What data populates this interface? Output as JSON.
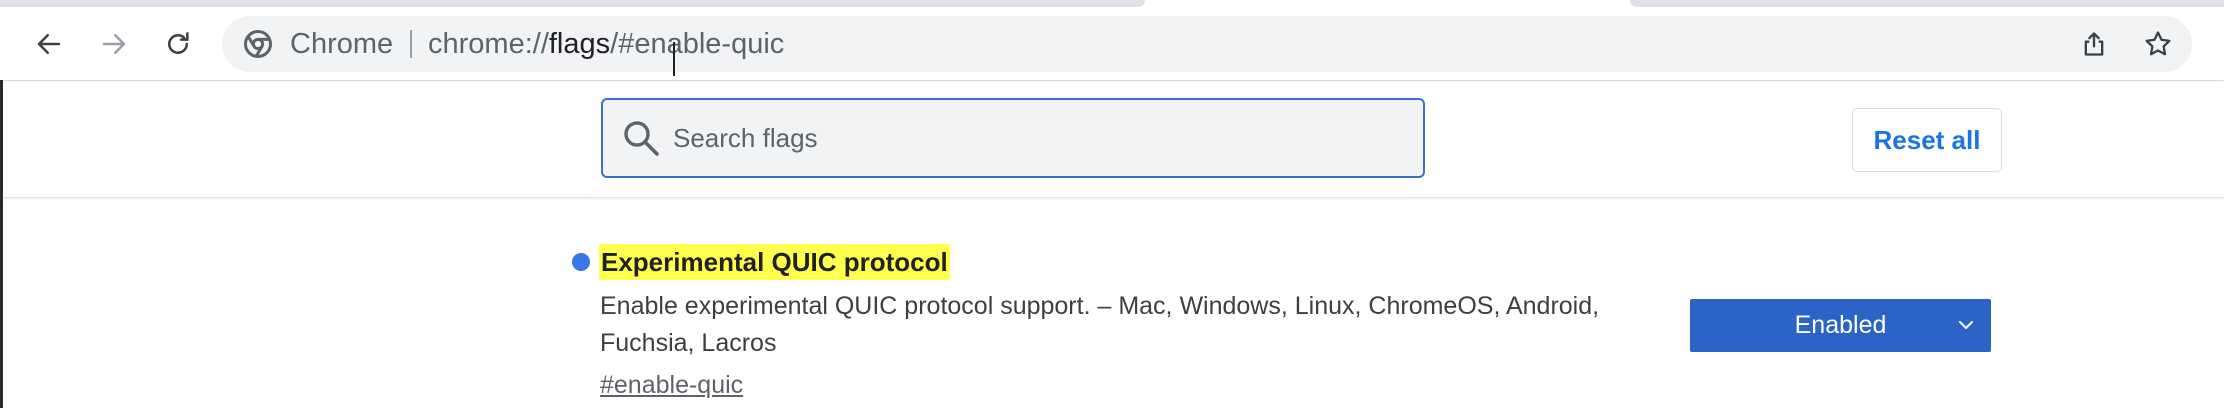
{
  "browser": {
    "chip_label": "Chrome",
    "url_scheme": "chrome://",
    "url_host": "flags",
    "url_path": "/#enable-quic",
    "icons": {
      "back": "arrow-left-icon",
      "forward": "arrow-right-icon",
      "reload": "reload-icon",
      "share": "share-icon",
      "bookmark": "star-icon",
      "site": "chrome-logo-icon"
    }
  },
  "flags_page": {
    "search": {
      "placeholder": "Search flags",
      "value": ""
    },
    "reset_label": "Reset all",
    "flag": {
      "title": "Experimental QUIC protocol",
      "description": "Enable experimental QUIC protocol support. – Mac, Windows, Linux, ChromeOS, Android, Fuchsia, Lacros",
      "link": "#enable-quic",
      "selected_option": "Enabled"
    }
  },
  "colors": {
    "accent_blue": "#1a73e8",
    "select_blue": "#2b64c6",
    "highlight_yellow": "#ffff4d",
    "modified_dot": "#3b78e7"
  }
}
